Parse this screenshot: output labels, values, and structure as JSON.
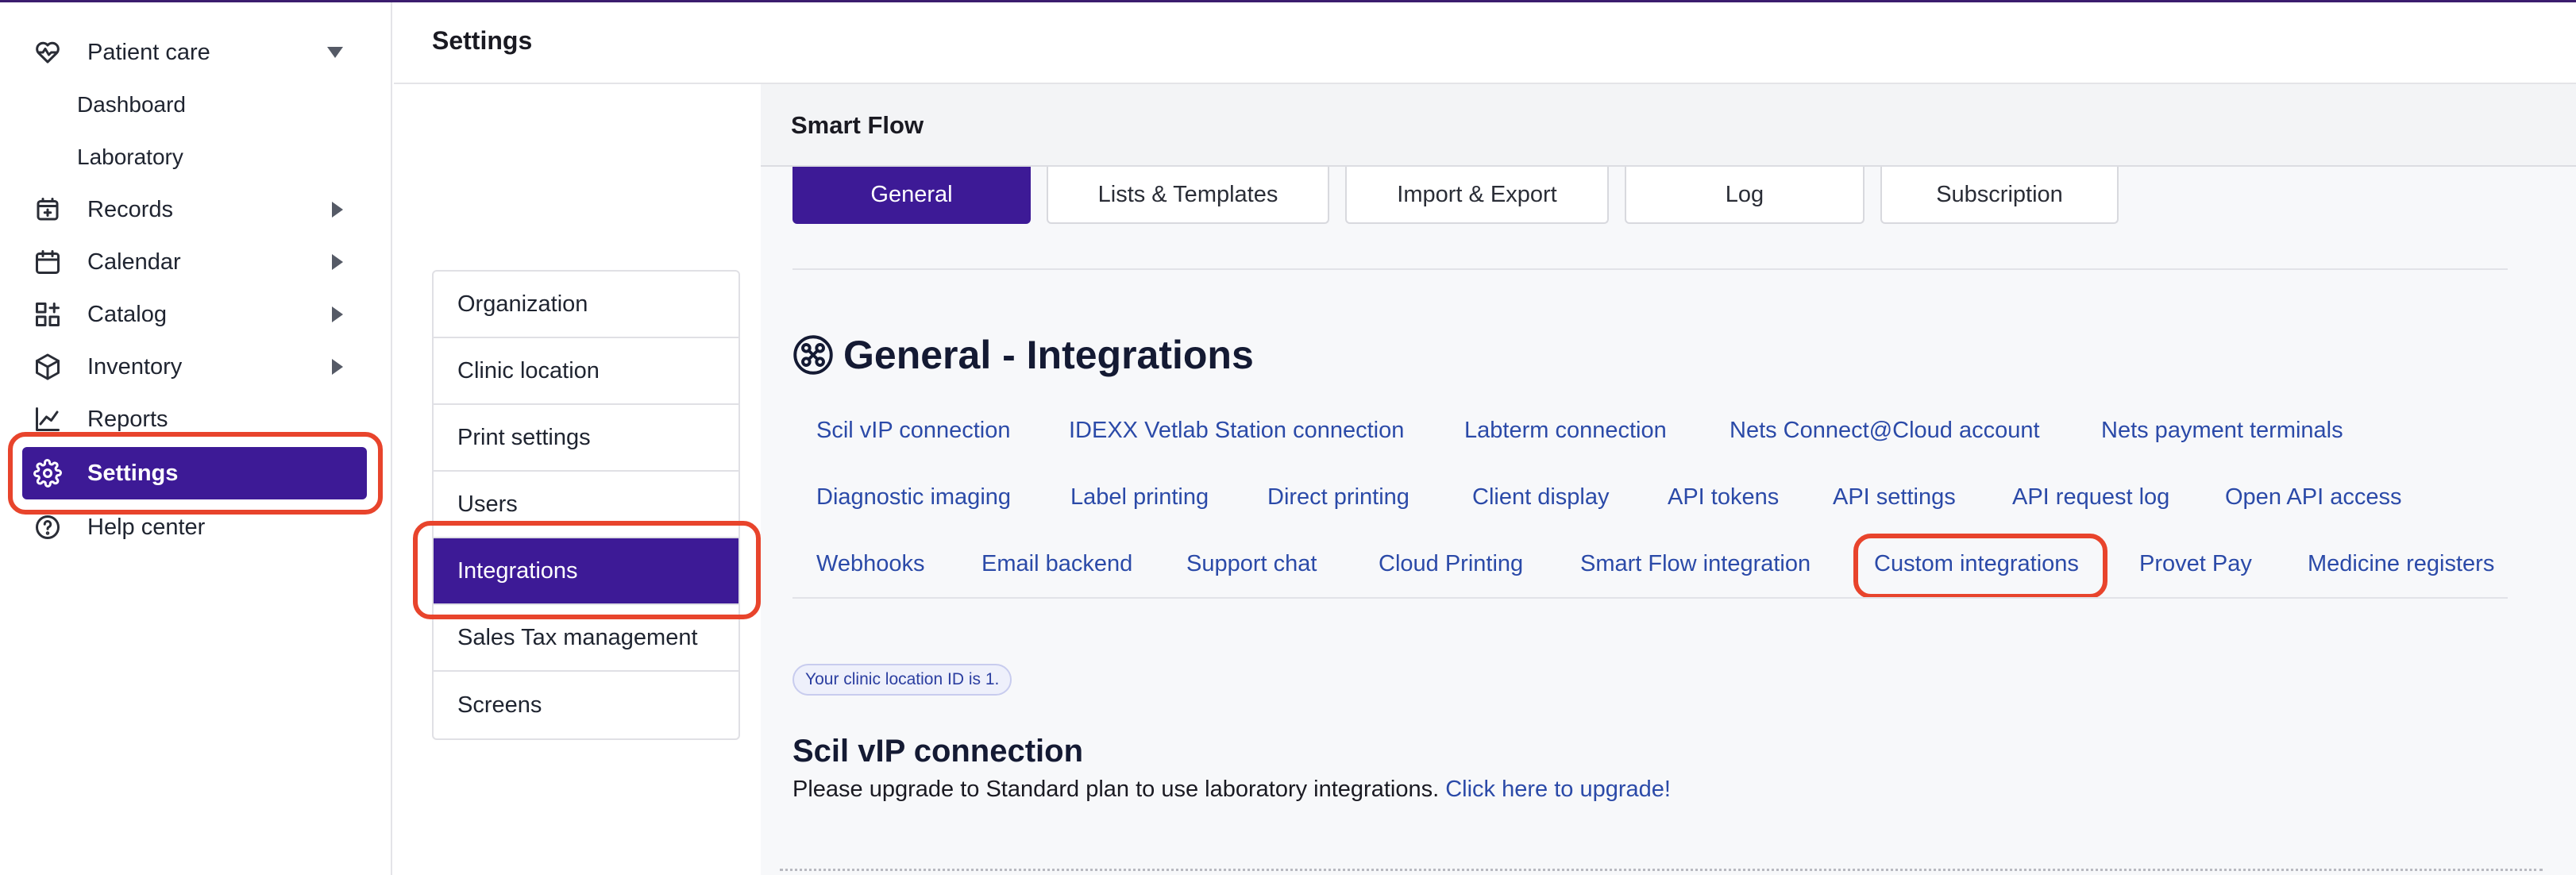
{
  "nav": {
    "patient_care": "Patient care",
    "dashboard": "Dashboard",
    "laboratory": "Laboratory",
    "records": "Records",
    "calendar": "Calendar",
    "catalog": "Catalog",
    "inventory": "Inventory",
    "reports": "Reports",
    "settings": "Settings",
    "help_center": "Help center"
  },
  "header": {
    "title": "Settings"
  },
  "settings_menu": {
    "items": [
      "Organization",
      "Clinic location",
      "Print settings",
      "Users",
      "Integrations",
      "Sales Tax management",
      "Screens"
    ],
    "active": "Integrations"
  },
  "smart_flow": {
    "title": "Smart Flow",
    "tabs": [
      "General",
      "Lists & Templates",
      "Import & Export",
      "Log",
      "Subscription"
    ],
    "active_tab": "General"
  },
  "integrations": {
    "title": "General - Integrations",
    "links_row1": [
      "Scil vIP connection",
      "IDEXX Vetlab Station connection",
      "Labterm connection",
      "Nets Connect@Cloud account",
      "Nets payment terminals"
    ],
    "links_row2": [
      "Diagnostic imaging",
      "Label printing",
      "Direct printing",
      "Client display",
      "API tokens",
      "API settings",
      "API request log",
      "Open API access"
    ],
    "links_row3": [
      "Webhooks",
      "Email backend",
      "Support chat",
      "Cloud Printing",
      "Smart Flow integration",
      "Custom integrations",
      "Provet Pay",
      "Medicine registers"
    ]
  },
  "clinic_badge": "Your clinic location ID is 1.",
  "scil": {
    "title": "Scil vIP connection",
    "text": "Please upgrade to Standard plan to use laboratory integrations.",
    "upgrade_link": "Click here to upgrade!"
  },
  "colors": {
    "accent": "#3d1a96",
    "link": "#2b4aa8",
    "highlight": "#e8442c"
  },
  "icons": [
    "heart-pulse-icon",
    "records-icon",
    "calendar-icon",
    "catalog-icon",
    "inventory-icon",
    "reports-icon",
    "gear-icon",
    "help-icon",
    "integrations-icon"
  ]
}
